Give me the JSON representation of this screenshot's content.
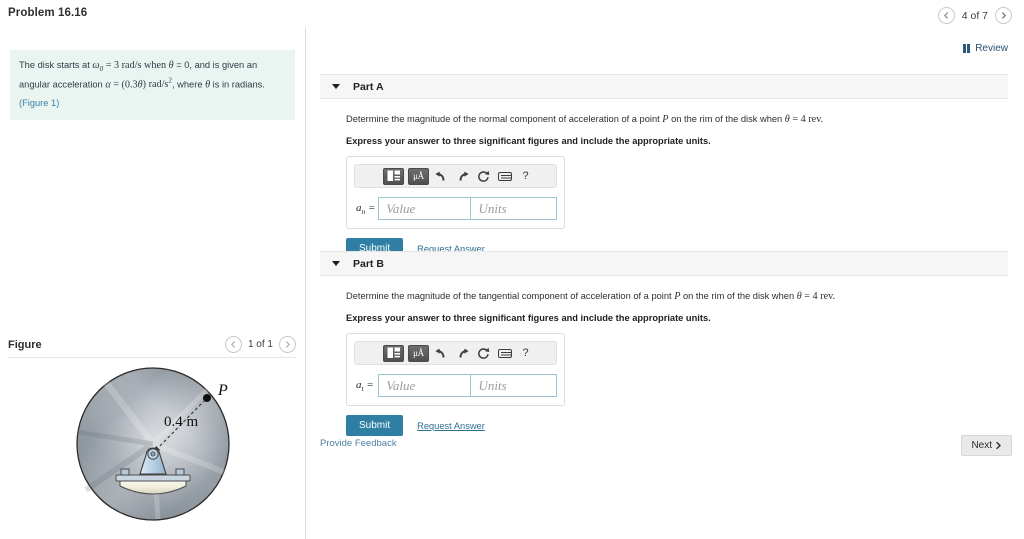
{
  "header": {
    "problem_title": "Problem 16.16",
    "pager_label": "4 of 7",
    "prev_icon": "chevron-left-icon",
    "next_icon": "chevron-right-icon",
    "review_label": "Review",
    "review_icon": "book-icon"
  },
  "statement": {
    "text_1": "The disk starts at ",
    "omega": "ω",
    "omega_sub": "0",
    "text_2": " = 3 rad/s when ",
    "theta": "θ",
    "text_3": " = 0, and is given an angular acceleration ",
    "alpha": "α",
    "text_4": " = (0.3",
    "theta_2": "θ",
    "text_5": ") rad/s",
    "sup": "2",
    "text_6": ", where ",
    "theta_3": "θ",
    "text_7": " is in radians.",
    "figure_ref": "(Figure 1)"
  },
  "figure": {
    "title": "Figure",
    "pager_label": "1 of 1",
    "prev_icon": "chevron-left-icon",
    "next_icon": "chevron-right-icon",
    "radius_label": "0.4 m",
    "point_label": "P",
    "disk_color": "#9aa3ab",
    "mount_color": "#b8cfe4",
    "base_color": "#efeede"
  },
  "parts": [
    {
      "id": "part-a",
      "title": "Part A",
      "caret_icon": "caret-down-icon",
      "prompt_1": "Determine the magnitude of the normal component of acceleration of a point ",
      "prompt_point": "P",
      "prompt_2": " on the rim of the disk when ",
      "prompt_theta": "θ",
      "prompt_3": " = 4 rev.",
      "instruction": "Express your answer to three significant figures and include the appropriate units.",
      "toolbar": {
        "template_icon": "template-blocks-icon",
        "units_label": "μÅ",
        "units_icon": "units-icon",
        "undo_icon": "undo-arrow-icon",
        "redo_icon": "redo-arrow-icon",
        "reset_icon": "reset-circle-icon",
        "keyboard_icon": "keyboard-icon",
        "help_label": "?",
        "help_icon": "help-question-icon"
      },
      "var_symbol": "a",
      "var_sub": "n",
      "var_equals": " =",
      "value_placeholder": "Value",
      "units_placeholder": "Units",
      "submit_label": "Submit",
      "request_answer_label": "Request Answer"
    },
    {
      "id": "part-b",
      "title": "Part B",
      "caret_icon": "caret-down-icon",
      "prompt_1": "Determine the magnitude of the tangential component of acceleration of a point ",
      "prompt_point": "P",
      "prompt_2": " on the rim of the disk when ",
      "prompt_theta": "θ",
      "prompt_3": " = 4 rev.",
      "instruction": "Express your answer to three significant figures and include the appropriate units.",
      "toolbar": {
        "template_icon": "template-blocks-icon",
        "units_label": "μÅ",
        "units_icon": "units-icon",
        "undo_icon": "undo-arrow-icon",
        "redo_icon": "redo-arrow-icon",
        "reset_icon": "reset-circle-icon",
        "keyboard_icon": "keyboard-icon",
        "help_label": "?",
        "help_icon": "help-question-icon"
      },
      "var_symbol": "a",
      "var_sub": "t",
      "var_equals": " =",
      "value_placeholder": "Value",
      "units_placeholder": "Units",
      "submit_label": "Submit",
      "request_answer_label": "Request Answer"
    }
  ],
  "footer": {
    "feedback_label": "Provide Feedback",
    "next_label": "Next",
    "next_icon": "chevron-right-icon"
  },
  "colors": {
    "accent_blue": "#2f7ea3",
    "link_blue": "#2f6f94",
    "statement_bg": "#eaf5f2",
    "part_header_bg": "#f6f6f6"
  }
}
